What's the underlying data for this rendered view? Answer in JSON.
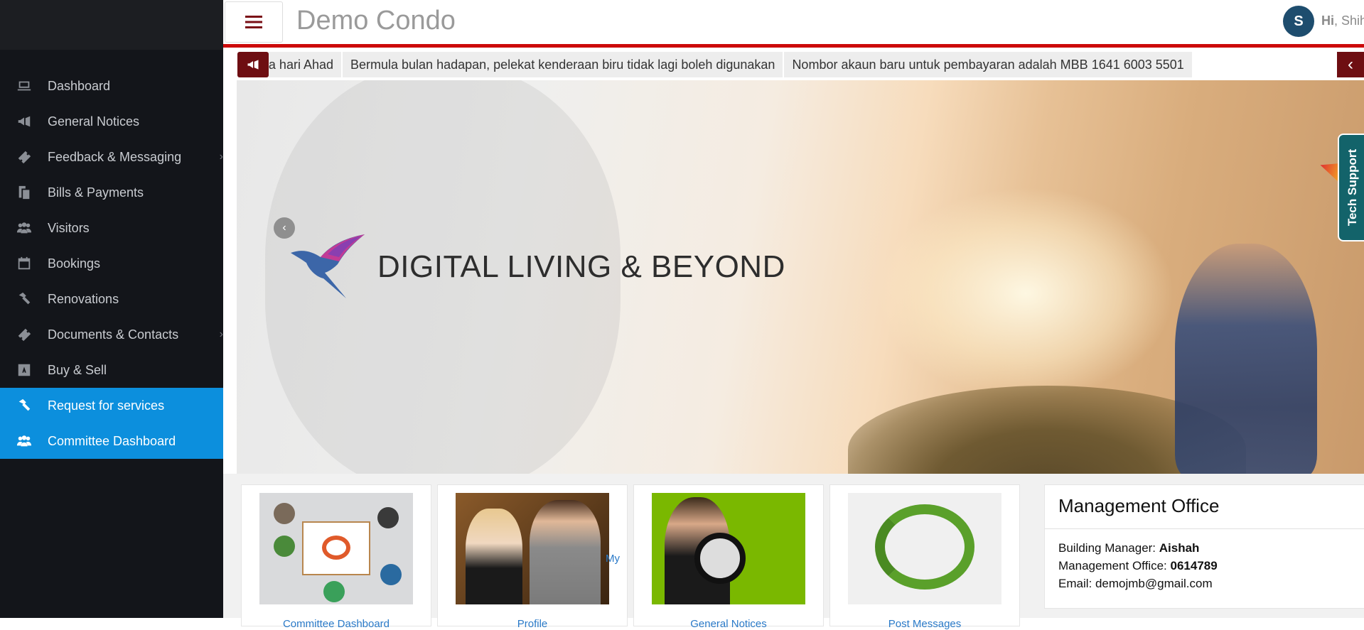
{
  "header": {
    "title": "Demo Condo",
    "avatar_initial": "S",
    "greeting_hi": "Hi",
    "greeting_name": ", Shih"
  },
  "sidebar": {
    "items": [
      {
        "label": "Dashboard",
        "icon": "laptop-icon"
      },
      {
        "label": "General Notices",
        "icon": "megaphone-icon"
      },
      {
        "label": "Feedback & Messaging",
        "icon": "ticket-icon",
        "chevron": "›"
      },
      {
        "label": "Bills & Payments",
        "icon": "copy-icon"
      },
      {
        "label": "Visitors",
        "icon": "users-icon"
      },
      {
        "label": "Bookings",
        "icon": "calendar-icon"
      },
      {
        "label": "Renovations",
        "icon": "hammer-icon"
      },
      {
        "label": "Documents & Contacts",
        "icon": "ticket-icon",
        "chevron": "›"
      },
      {
        "label": "Buy & Sell",
        "icon": "amazon-icon"
      },
      {
        "label": "Request for services",
        "icon": "hammer-icon"
      },
      {
        "label": "Committee Dashboard",
        "icon": "users-icon"
      }
    ]
  },
  "ticker": {
    "items": [
      "a hari Ahad",
      "Bermula bulan hadapan, pelekat kenderaan biru tidak lagi boleh digunakan",
      "Nombor akaun baru untuk pembayaran adalah MBB 1641 6003 5501"
    ],
    "next_glyph": "‹"
  },
  "banner": {
    "logo_text": "DIGITAL LIVING & BEYOND",
    "prev_glyph": "‹"
  },
  "tech_support": "Tech Support",
  "cards": [
    {
      "label": "Committee Dashboard"
    },
    {
      "label": "Profile",
      "side_label": "My"
    },
    {
      "label": "General Notices"
    },
    {
      "label": "Post Messages"
    }
  ],
  "management_office": {
    "title": "Management Office",
    "building_manager_label": "Building Manager: ",
    "building_manager": "Aishah",
    "office_label": "Management Office: ",
    "office_phone": "0614789",
    "email_label": "Email: ",
    "email": "demojmb@gmail.com"
  },
  "colors": {
    "sidebar_bg": "#13151a",
    "active_item": "#0c8fdd",
    "accent_red": "#cc0a0a",
    "brand_dark_red": "#6e0e12",
    "tech_support_bg": "#13636a",
    "link_blue": "#2a7ac8"
  }
}
